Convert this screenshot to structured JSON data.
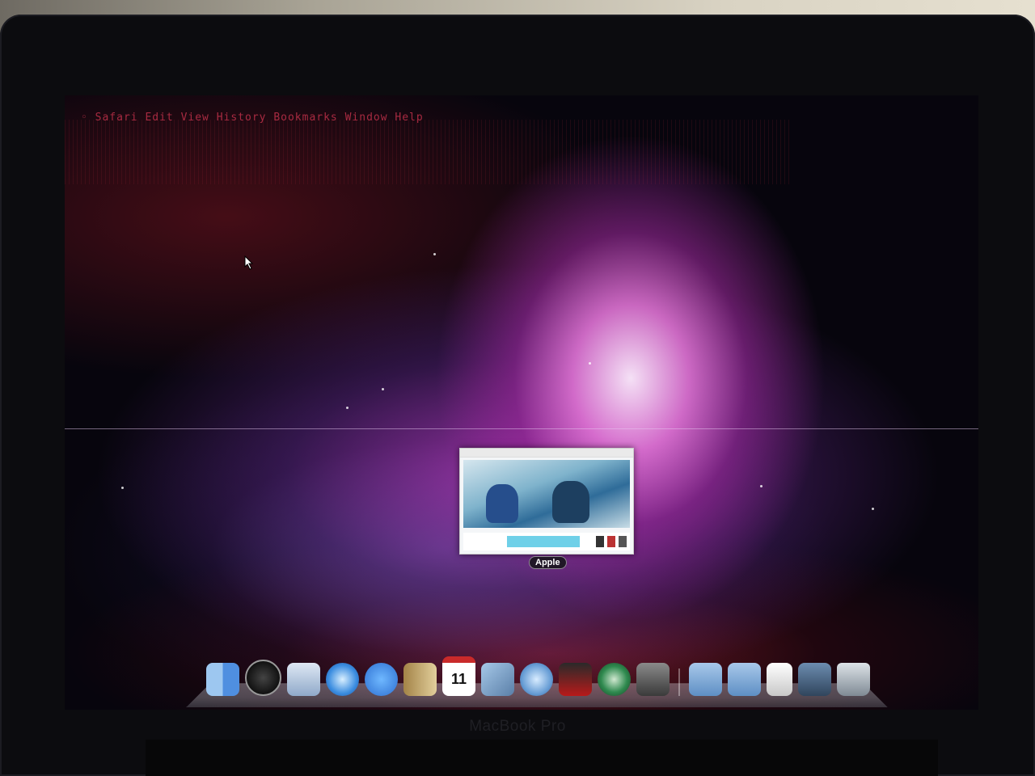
{
  "preview_window": {
    "tooltip_label": "Apple"
  },
  "dock": {
    "items": [
      {
        "name": "finder-icon",
        "glyph": ""
      },
      {
        "name": "dashboard-icon",
        "glyph": ""
      },
      {
        "name": "mail-icon",
        "glyph": ""
      },
      {
        "name": "safari-icon",
        "glyph": ""
      },
      {
        "name": "ichat-icon",
        "glyph": ""
      },
      {
        "name": "address-book-icon",
        "glyph": ""
      },
      {
        "name": "ical-icon",
        "glyph": "11"
      },
      {
        "name": "iphoto-icon",
        "glyph": ""
      },
      {
        "name": "itunes-icon",
        "glyph": ""
      },
      {
        "name": "photo-booth-icon",
        "glyph": ""
      },
      {
        "name": "time-machine-icon",
        "glyph": ""
      },
      {
        "name": "system-preferences-icon",
        "glyph": ""
      },
      {
        "name": "applications-folder-icon",
        "glyph": ""
      },
      {
        "name": "documents-folder-icon",
        "glyph": ""
      },
      {
        "name": "document-stack-icon",
        "glyph": ""
      },
      {
        "name": "pictures-stack-icon",
        "glyph": ""
      },
      {
        "name": "trash-icon",
        "glyph": ""
      }
    ]
  },
  "laptop": {
    "brand": "MacBook Pro"
  },
  "colors": {
    "wallpaper_accent": "#c23ab8",
    "garbled_text": "#c0314a",
    "bezel": "#0c0c0f"
  }
}
